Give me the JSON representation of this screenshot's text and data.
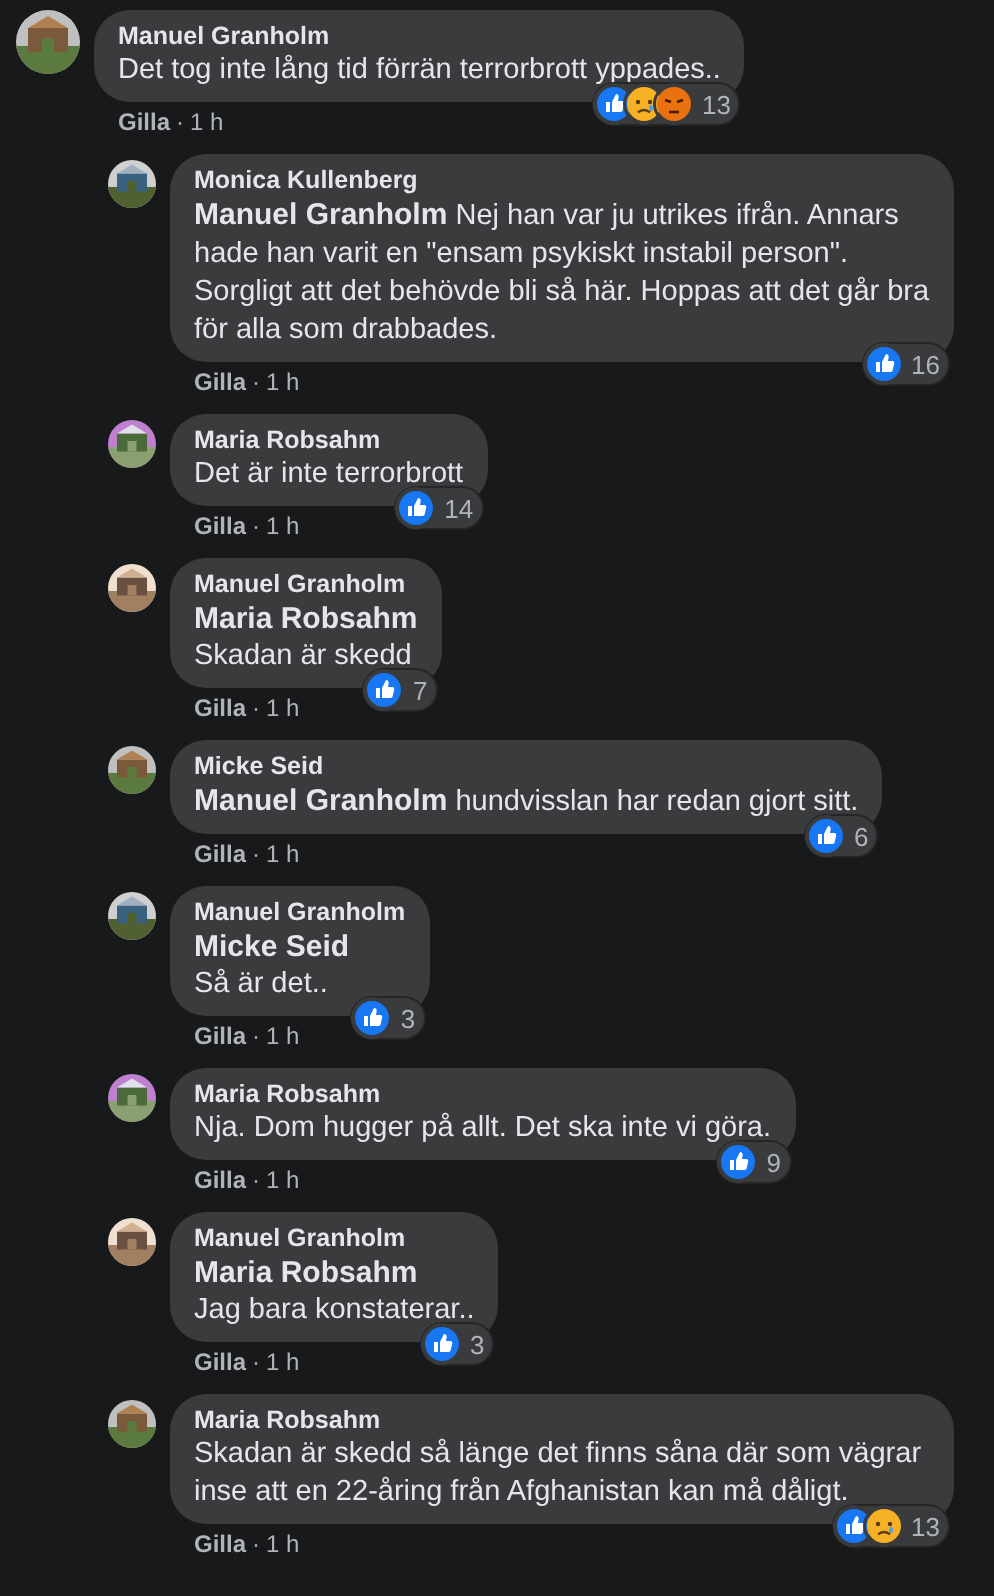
{
  "comments": [
    {
      "author": "Manuel Granholm",
      "text": "Det tog inte lång tid förrän terrorbrott yppades..",
      "reactions": [
        {
          "kind": "like"
        },
        {
          "kind": "sad"
        },
        {
          "kind": "angry"
        }
      ],
      "count": "13",
      "like_label": "Gilla",
      "separator": "·",
      "time": "1 h",
      "replies": [
        {
          "author": "Monica Kullenberg",
          "mention": "Manuel Granholm",
          "mention_own_line": false,
          "text": "Nej han var ju utrikes ifrån. Annars hade han varit en \"ensam psykiskt instabil person\". Sorgligt att det behövde bli så här. Hoppas att det går bra för alla som drabbades.",
          "reactions": [
            {
              "kind": "like"
            }
          ],
          "count": "16",
          "like_label": "Gilla",
          "separator": "·",
          "time": "1 h"
        },
        {
          "author": "Maria Robsahm",
          "text": "Det är inte terrorbrott",
          "reactions": [
            {
              "kind": "like"
            }
          ],
          "count": "14",
          "like_label": "Gilla",
          "separator": "·",
          "time": "1 h"
        },
        {
          "author": "Manuel Granholm",
          "mention": "Maria Robsahm",
          "mention_own_line": true,
          "text": "Skadan är skedd",
          "reactions": [
            {
              "kind": "like"
            }
          ],
          "count": "7",
          "like_label": "Gilla",
          "separator": "·",
          "time": "1 h"
        },
        {
          "author": "Micke Seid",
          "mention": "Manuel Granholm",
          "mention_own_line": false,
          "text": "hundvisslan har redan gjort sitt.",
          "reactions": [
            {
              "kind": "like"
            }
          ],
          "count": "6",
          "like_label": "Gilla",
          "separator": "·",
          "time": "1 h"
        },
        {
          "author": "Manuel Granholm",
          "mention": "Micke Seid",
          "mention_own_line": true,
          "text": "Så är det..",
          "reactions": [
            {
              "kind": "like"
            }
          ],
          "count": "3",
          "like_label": "Gilla",
          "separator": "·",
          "time": "1 h"
        },
        {
          "author": "Maria Robsahm",
          "text": "Nja. Dom hugger på allt. Det ska inte vi göra.",
          "reactions": [
            {
              "kind": "like"
            }
          ],
          "count": "9",
          "like_label": "Gilla",
          "separator": "·",
          "time": "1 h"
        },
        {
          "author": "Manuel Granholm",
          "mention": "Maria Robsahm",
          "mention_own_line": true,
          "text": "Jag bara konstaterar..",
          "reactions": [
            {
              "kind": "like"
            }
          ],
          "count": "3",
          "like_label": "Gilla",
          "separator": "·",
          "time": "1 h"
        },
        {
          "author": "Maria Robsahm",
          "text": "Skadan är skedd så länge det finns såna där som vägrar inse att en 22-åring från Afghanistan kan må dåligt.",
          "reactions": [
            {
              "kind": "like"
            },
            {
              "kind": "sad"
            }
          ],
          "count": "13",
          "like_label": "Gilla",
          "separator": "·",
          "time": "1 h"
        }
      ]
    }
  ]
}
